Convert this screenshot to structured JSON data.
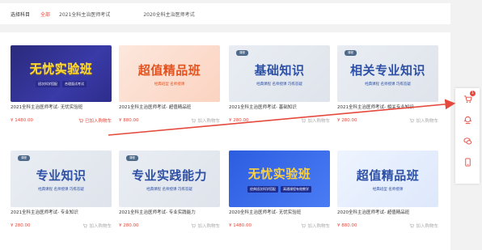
{
  "filter": {
    "label": "选择科目",
    "items": [
      {
        "label": "全部",
        "active": true
      },
      {
        "label": "2021全科主治医师考试",
        "active": false
      },
      {
        "label": "2020全科主治医师考试",
        "active": false
      }
    ]
  },
  "cards": [
    {
      "theme": "t-navy",
      "big": "无忧实验班",
      "sub": "",
      "tag": "",
      "badges": [
        "班次科学搭配",
        "合理面试考试"
      ],
      "title": "2021全科主治医师考试- 无忧实验班",
      "price": "¥ 1480.00",
      "cart": "已加入购物车",
      "added": true
    },
    {
      "theme": "t-peach",
      "big": "超值精品班",
      "sub": "经典班型 名师授课",
      "tag": "",
      "badges": [],
      "title": "2021全科主治医师考试- 超值精品班",
      "price": "¥ 880.00",
      "cart": "加入购物车",
      "added": false
    },
    {
      "theme": "t-grey",
      "big": "基础知识",
      "sub": "经典课程 名师授课 巧练答疑",
      "tag": "课程",
      "badges": [],
      "title": "2021全科主治医师考试- 基础知识",
      "price": "¥ 280.00",
      "cart": "加入购物车",
      "added": false
    },
    {
      "theme": "t-grey",
      "big": "相关专业知识",
      "sub": "经典课程 名师授课 巧练答疑",
      "tag": "课程",
      "badges": [],
      "title": "2021全科主治医师考试- 相关专业知识",
      "price": "¥ 280.00",
      "cart": "加入购物车",
      "added": false
    },
    {
      "theme": "t-grey",
      "big": "专业知识",
      "sub": "经典课程 名师授课 巧练答疑",
      "tag": "课程",
      "badges": [],
      "title": "2021全科主治医师考试- 专业知识",
      "price": "¥ 280.00",
      "cart": "加入购物车",
      "added": false
    },
    {
      "theme": "t-grey",
      "big": "专业实践能力",
      "sub": "经典课程 名师授课 巧练答疑",
      "tag": "课程",
      "badges": [],
      "title": "2021全科主治医师考试- 专业实践能力",
      "price": "¥ 280.00",
      "cart": "加入购物车",
      "added": false
    },
    {
      "theme": "t-blue",
      "big": "无忧实验班",
      "sub": "",
      "tag": "",
      "badges": [
        "经典班次科学搭配",
        "高通课程有效教学"
      ],
      "title": "2020全科主治医师考试- 无忧实验班",
      "price": "¥ 1480.00",
      "cart": "加入购物车",
      "added": false
    },
    {
      "theme": "t-light",
      "big": "超值精品班",
      "sub": "经典班型 名师授课",
      "tag": "",
      "badges": [],
      "title": "2020全科主治医师考试- 超值精品班",
      "price": "¥ 880.00",
      "cart": "加入购物车",
      "added": false
    }
  ],
  "side": {
    "cart_count": "1",
    "icons": [
      "cart-icon",
      "customer-service-icon",
      "chat-icon",
      "mobile-icon"
    ]
  },
  "colors": {
    "accent": "#e4493c",
    "arrow": "#e4493c"
  }
}
